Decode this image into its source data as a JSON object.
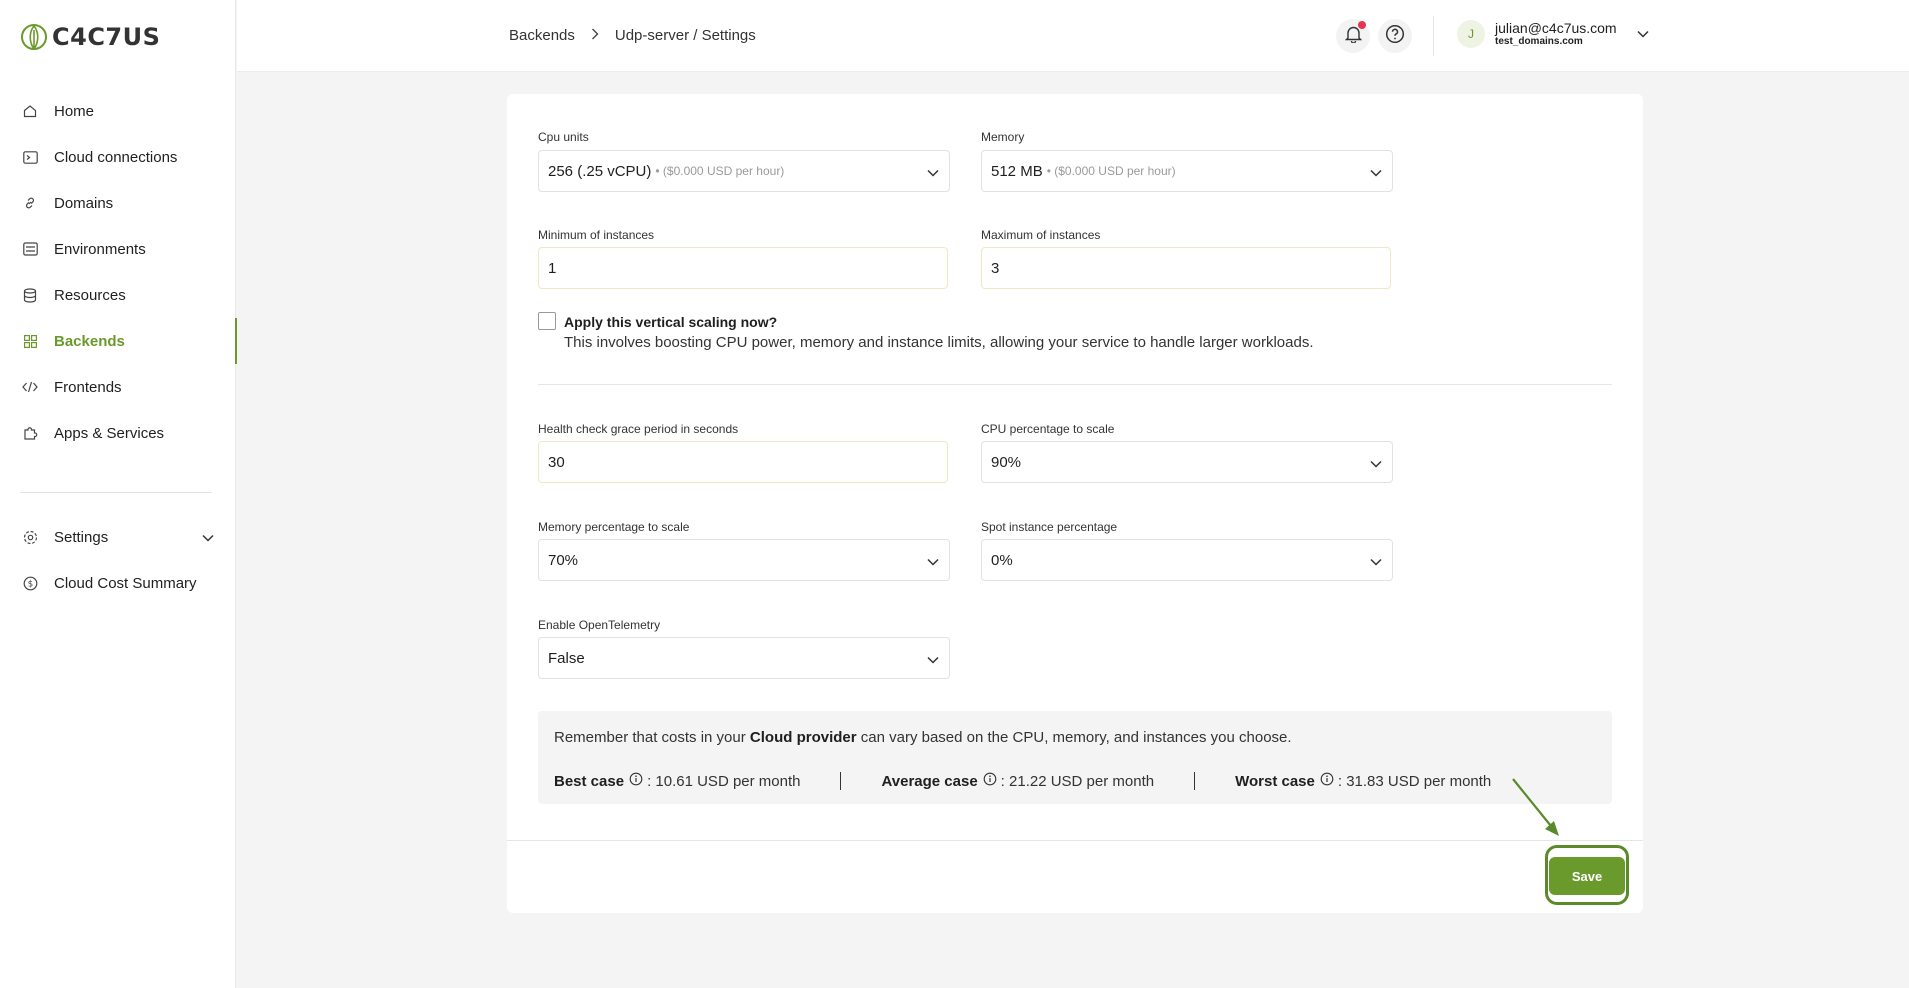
{
  "app": {
    "logo_text": "C4C7US"
  },
  "sidebar": {
    "items": [
      {
        "label": "Home",
        "icon": "home-icon"
      },
      {
        "label": "Cloud connections",
        "icon": "terminal-icon"
      },
      {
        "label": "Domains",
        "icon": "link-icon"
      },
      {
        "label": "Environments",
        "icon": "layers-icon"
      },
      {
        "label": "Resources",
        "icon": "database-icon"
      },
      {
        "label": "Backends",
        "icon": "grid-icon",
        "active": true
      },
      {
        "label": "Frontends",
        "icon": "code-icon"
      },
      {
        "label": "Apps & Services",
        "icon": "puzzle-icon"
      }
    ],
    "secondary": [
      {
        "label": "Settings",
        "icon": "gear-icon"
      },
      {
        "label": "Cloud Cost Summary",
        "icon": "dollar-icon"
      }
    ]
  },
  "header": {
    "breadcrumb": [
      "Backends",
      "Udp-server / Settings"
    ],
    "user": {
      "initial": "J",
      "email": "julian@c4c7us.com",
      "domain": "test_domains.com"
    }
  },
  "form": {
    "cpu": {
      "label": "Cpu units",
      "value": "256 (.25 vCPU)",
      "sub": "• ($0.000 USD per hour)"
    },
    "memory": {
      "label": "Memory",
      "value": "512 MB",
      "sub": "• ($0.000 USD per hour)"
    },
    "min_instances": {
      "label": "Minimum of instances",
      "value": "1"
    },
    "max_instances": {
      "label": "Maximum of instances",
      "value": "3"
    },
    "vertical_scaling": {
      "title": "Apply this vertical scaling now?",
      "desc": "This involves boosting CPU power, memory and instance limits, allowing your service to handle larger workloads."
    },
    "health_grace": {
      "label": "Health check grace period in seconds",
      "value": "30"
    },
    "cpu_pct": {
      "label": "CPU percentage to scale",
      "value": "90%"
    },
    "mem_pct": {
      "label": "Memory percentage to scale",
      "value": "70%"
    },
    "spot_pct": {
      "label": "Spot instance percentage",
      "value": "0%"
    },
    "otel": {
      "label": "Enable OpenTelemetry",
      "value": "False"
    }
  },
  "cost": {
    "note_prefix": "Remember that costs in your",
    "note_bold": "Cloud provider",
    "note_suffix": "can vary based on the CPU, memory, and instances you choose.",
    "best_label": "Best case",
    "best_value": ": 10.61 USD per month",
    "avg_label": "Average case",
    "avg_value": ": 21.22 USD per month",
    "worst_label": "Worst case",
    "worst_value": ": 31.83 USD per month"
  },
  "actions": {
    "save_label": "Save"
  },
  "colors": {
    "accent": "#6b9a2c",
    "notification": "#e8344e"
  }
}
